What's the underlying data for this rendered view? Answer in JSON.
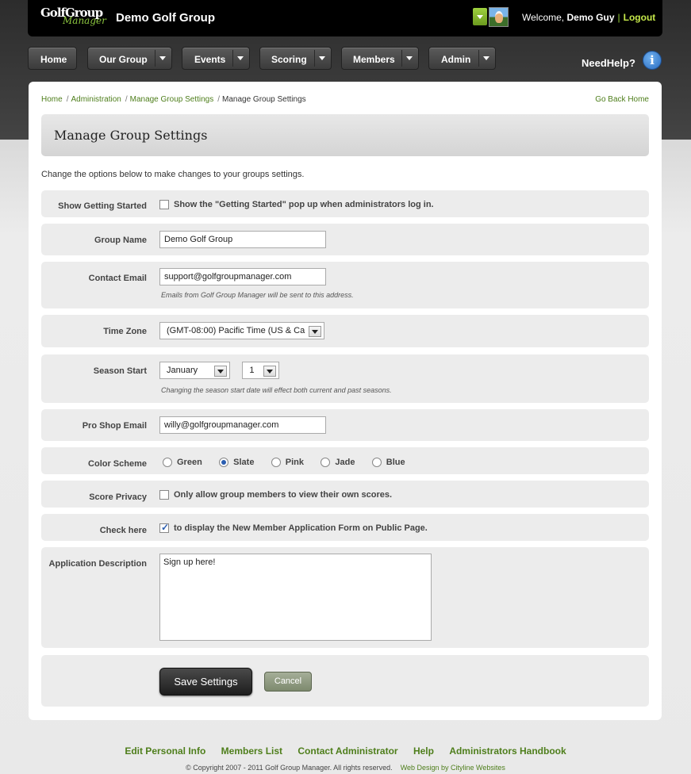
{
  "header": {
    "logo_text": "GolfGroup",
    "logo_sub": "Manager",
    "group_name": "Demo Golf Group",
    "welcome_prefix": "Welcome,",
    "user_name": "Demo Guy",
    "separator": "|",
    "logout": "Logout"
  },
  "nav": {
    "items": [
      {
        "label": "Home"
      },
      {
        "label": "Our Group"
      },
      {
        "label": "Events"
      },
      {
        "label": "Scoring"
      },
      {
        "label": "Members"
      },
      {
        "label": "Admin"
      }
    ],
    "need_help": "NeedHelp?",
    "info_glyph": "i"
  },
  "breadcrumb": {
    "items": [
      "Home",
      "Administration",
      "Manage Group Settings"
    ],
    "current": "Manage Group Settings",
    "separator": "/",
    "go_back": "Go Back Home"
  },
  "page": {
    "title": "Manage Group Settings",
    "intro": "Change the options below to make changes to your groups settings."
  },
  "form": {
    "getting_started": {
      "label": "Show Getting Started",
      "text": "Show the \"Getting Started\" pop up when administrators log in.",
      "checked": false
    },
    "group_name": {
      "label": "Group Name",
      "value": "Demo Golf Group"
    },
    "contact_email": {
      "label": "Contact Email",
      "value": "support@golfgroupmanager.com",
      "hint": "Emails from Golf Group Manager will be sent to this address."
    },
    "time_zone": {
      "label": "Time Zone",
      "value": "(GMT-08:00) Pacific Time (US & Ca"
    },
    "season_start": {
      "label": "Season Start",
      "month": "January",
      "day": "1",
      "hint": "Changing the season start date will effect both current and past seasons."
    },
    "pro_shop_email": {
      "label": "Pro Shop Email",
      "value": "willy@golfgroupmanager.com"
    },
    "color_scheme": {
      "label": "Color Scheme",
      "options": [
        "Green",
        "Slate",
        "Pink",
        "Jade",
        "Blue"
      ],
      "selected": "Slate"
    },
    "score_privacy": {
      "label": "Score Privacy",
      "text": "Only allow group members to view their own scores.",
      "checked": false
    },
    "check_here": {
      "label": "Check here",
      "text": "to display the New Member Application Form on Public Page.",
      "checked": true
    },
    "app_description": {
      "label": "Application Description",
      "value": "Sign up here!"
    },
    "save_label": "Save Settings",
    "cancel_label": "Cancel"
  },
  "footer": {
    "links": [
      "Edit Personal Info",
      "Members List",
      "Contact Administrator",
      "Help",
      "Administrators Handbook"
    ],
    "copyright": "© Copyright 2007 - 2011 Golf Group Manager. All rights reserved.",
    "web_design": "Web Design by Cityline Websites"
  },
  "colors": {
    "accent_green": "#4e7e1b",
    "header_bg": "#000000",
    "radio_blue": "#2a5db0"
  }
}
